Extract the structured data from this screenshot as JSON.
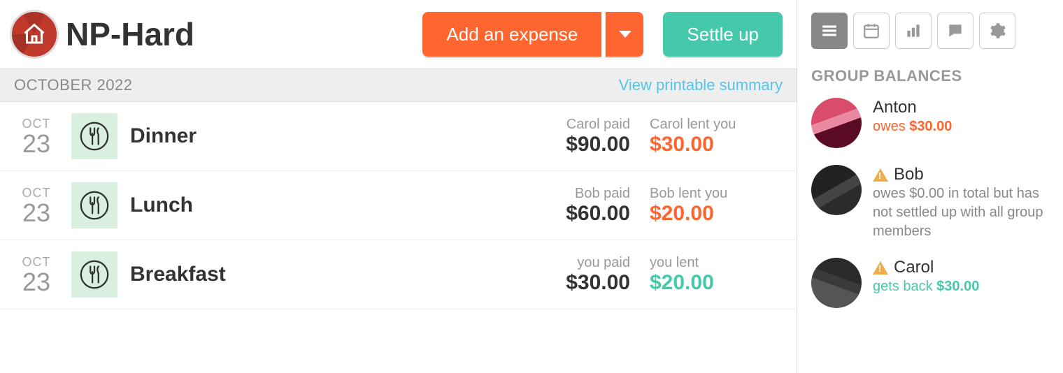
{
  "header": {
    "group_name": "NP-Hard",
    "add_expense_label": "Add an expense",
    "settle_up_label": "Settle up"
  },
  "month_bar": {
    "label": "OCTOBER 2022",
    "printable_link": "View printable summary"
  },
  "expenses": [
    {
      "month": "OCT",
      "day": "23",
      "title": "Dinner",
      "paid_label": "Carol paid",
      "paid_amount": "$90.00",
      "lent_label": "Carol lent you",
      "lent_amount": "$30.00",
      "lent_class": "neg"
    },
    {
      "month": "OCT",
      "day": "23",
      "title": "Lunch",
      "paid_label": "Bob paid",
      "paid_amount": "$60.00",
      "lent_label": "Bob lent you",
      "lent_amount": "$20.00",
      "lent_class": "neg"
    },
    {
      "month": "OCT",
      "day": "23",
      "title": "Breakfast",
      "paid_label": "you paid",
      "paid_amount": "$30.00",
      "lent_label": "you lent",
      "lent_amount": "$20.00",
      "lent_class": "pos"
    }
  ],
  "sidebar": {
    "heading": "GROUP BALANCES",
    "balances": [
      {
        "name": "Anton",
        "warn": false,
        "avatar_class": "pink",
        "text_prefix": "owes ",
        "amount": "$30.00",
        "text_suffix": "",
        "class": "neg"
      },
      {
        "name": "Bob",
        "warn": true,
        "avatar_class": "dark1",
        "text_prefix": "owes $0.00 in total but has not settled up with all group members",
        "amount": "",
        "text_suffix": "",
        "class": "muted"
      },
      {
        "name": "Carol",
        "warn": true,
        "avatar_class": "dark2",
        "text_prefix": "gets back ",
        "amount": "$30.00",
        "text_suffix": "",
        "class": "pos"
      }
    ]
  }
}
